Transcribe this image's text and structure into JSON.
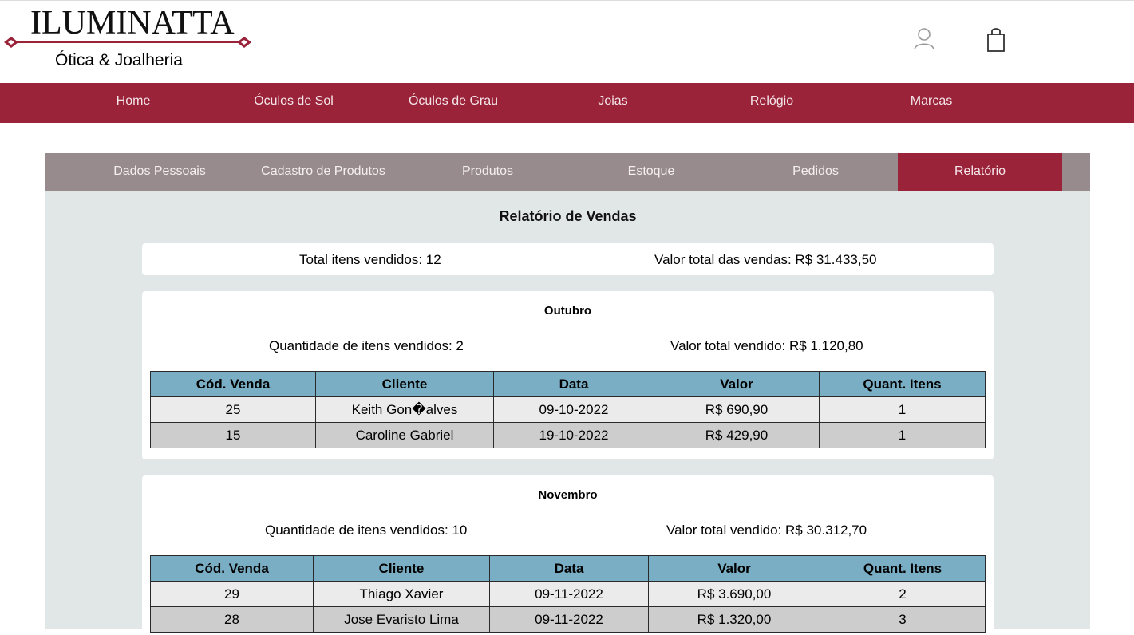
{
  "brand": {
    "name": "ILUMINATTA",
    "tagline": "Ótica & Joalheria",
    "accent": "#9a2239"
  },
  "header_icons": [
    "user-icon",
    "shopping-bag-icon"
  ],
  "main_nav": [
    "Home",
    "Óculos de Sol",
    "Óculos de Grau",
    "Joias",
    "Relógio",
    "Marcas"
  ],
  "sub_nav": {
    "tabs": [
      "Dados Pessoais",
      "Cadastro de Produtos",
      "Produtos",
      "Estoque",
      "Pedidos",
      "Relatório"
    ],
    "active": "Relatório"
  },
  "report": {
    "title": "Relatório de Vendas",
    "total_items": "Total itens vendidos: 12",
    "total_value": "Valor total das vendas: R$ 31.433,50"
  },
  "table_headers": [
    "Cód. Venda",
    "Cliente",
    "Data",
    "Valor",
    "Quant. Itens"
  ],
  "months": [
    {
      "name": "Outubro",
      "qty": "Quantidade de itens vendidos: 2",
      "total": "Valor total vendido: R$ 1.120,80",
      "rows": [
        [
          "25",
          "Keith Gon�alves",
          "09-10-2022",
          "R$ 690,90",
          "1"
        ],
        [
          "15",
          "Caroline Gabriel",
          "19-10-2022",
          "R$ 429,90",
          "1"
        ]
      ]
    },
    {
      "name": "Novembro",
      "qty": "Quantidade de itens vendidos: 10",
      "total": "Valor total vendido: R$ 30.312,70",
      "rows": [
        [
          "29",
          "Thiago Xavier",
          "09-11-2022",
          "R$ 3.690,00",
          "2"
        ],
        [
          "28",
          "Jose Evaristo Lima",
          "09-11-2022",
          "R$ 1.320,00",
          "3"
        ]
      ]
    }
  ]
}
